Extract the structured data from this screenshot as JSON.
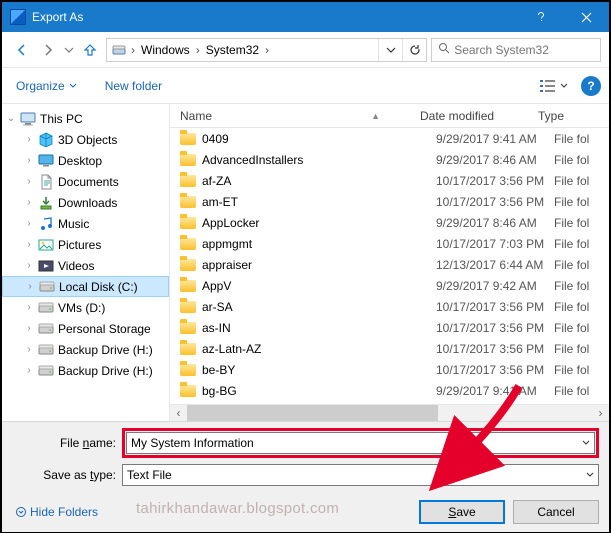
{
  "window": {
    "title": "Export As"
  },
  "breadcrumb": {
    "segments": [
      "Windows",
      "System32"
    ],
    "refresh_tip": "Refresh"
  },
  "search": {
    "placeholder": "Search System32"
  },
  "toolbar": {
    "organize": "Organize",
    "new_folder": "New folder"
  },
  "columns": {
    "name": "Name",
    "date": "Date modified",
    "type": "Type"
  },
  "sidebar": {
    "root": "This PC",
    "items": [
      {
        "label": "3D Objects",
        "icon": "3d"
      },
      {
        "label": "Desktop",
        "icon": "desktop"
      },
      {
        "label": "Documents",
        "icon": "documents"
      },
      {
        "label": "Downloads",
        "icon": "downloads"
      },
      {
        "label": "Music",
        "icon": "music"
      },
      {
        "label": "Pictures",
        "icon": "pictures"
      },
      {
        "label": "Videos",
        "icon": "videos"
      },
      {
        "label": "Local Disk (C:)",
        "icon": "drive",
        "selected": true
      },
      {
        "label": "VMs (D:)",
        "icon": "drive"
      },
      {
        "label": "Personal Storage",
        "icon": "drive"
      },
      {
        "label": "Backup Drive (H:)",
        "icon": "drive"
      },
      {
        "label": "Backup Drive (H:)",
        "icon": "drive"
      }
    ]
  },
  "files": [
    {
      "name": "0409",
      "date": "9/29/2017 9:41 AM",
      "type": "File fol"
    },
    {
      "name": "AdvancedInstallers",
      "date": "9/29/2017 8:46 AM",
      "type": "File fol"
    },
    {
      "name": "af-ZA",
      "date": "10/17/2017 3:56 PM",
      "type": "File fol"
    },
    {
      "name": "am-ET",
      "date": "10/17/2017 3:56 PM",
      "type": "File fol"
    },
    {
      "name": "AppLocker",
      "date": "9/29/2017 8:46 AM",
      "type": "File fol"
    },
    {
      "name": "appmgmt",
      "date": "10/17/2017 7:03 PM",
      "type": "File fol"
    },
    {
      "name": "appraiser",
      "date": "12/13/2017 6:44 AM",
      "type": "File fol"
    },
    {
      "name": "AppV",
      "date": "9/29/2017 9:42 AM",
      "type": "File fol"
    },
    {
      "name": "ar-SA",
      "date": "10/17/2017 3:56 PM",
      "type": "File fol"
    },
    {
      "name": "as-IN",
      "date": "10/17/2017 3:56 PM",
      "type": "File fol"
    },
    {
      "name": "az-Latn-AZ",
      "date": "10/17/2017 3:56 PM",
      "type": "File fol"
    },
    {
      "name": "be-BY",
      "date": "10/17/2017 3:56 PM",
      "type": "File fol"
    },
    {
      "name": "bg-BG",
      "date": "9/29/2017 9:41 AM",
      "type": "File fol"
    }
  ],
  "form": {
    "filename_label": "File name:",
    "filename_value": "My System Information",
    "savetype_label": "Save as type:",
    "savetype_value": "Text File"
  },
  "actions": {
    "hide_folders": "Hide Folders",
    "save": "Save",
    "cancel": "Cancel"
  },
  "watermark": "tahirkhandawar.blogspot.com"
}
